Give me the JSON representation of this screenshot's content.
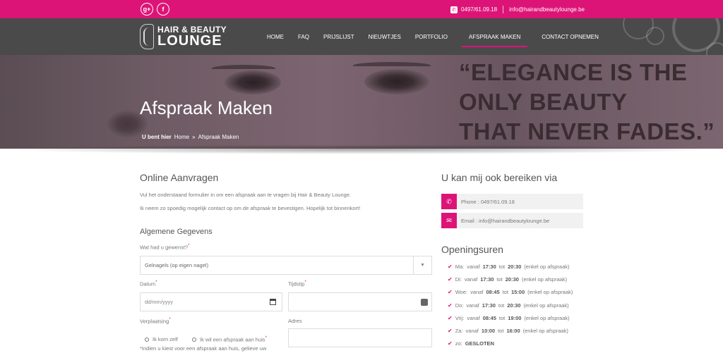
{
  "topbar": {
    "social": [
      {
        "name": "google-plus",
        "glyph": "g+"
      },
      {
        "name": "facebook",
        "glyph": "f"
      }
    ],
    "phone": "0497/61.09.18",
    "email": "info@hairandbeautylounge.be"
  },
  "logo": {
    "line1": "HAIR & BEAUTY",
    "line2": "LOUNGE"
  },
  "menu": [
    "HOME",
    "FAQ",
    "PRIJSLIJST",
    "NIEUWTJES",
    "PORTFOLIO",
    "AFSPRAAK MAKEN",
    "CONTACT OPNEMEN"
  ],
  "hero": {
    "title": "Afspraak Maken",
    "breadcrumb": {
      "prefix": "U bent hier",
      "home": "Home",
      "separator": "»",
      "current": "Afspraak Maken"
    },
    "quote": [
      "“ELEGANCE IS THE",
      "ONLY BEAUTY",
      "THAT NEVER FADES.”"
    ]
  },
  "form": {
    "heading": "Online Aanvragen",
    "intro1": "Vul het onderstaand formulier in om een afspraak aan te vragen bij Hair & Beauty Lounge.",
    "intro2": "Ik neem zo spoedig mogelijk contact op om de afspraak te bevestigen. Hopelijk tot binnenkort!",
    "section": "Algemene Gegevens",
    "wish_label": "Wat had u gewenst?",
    "wish_value": "Gelnagels (op eigen nagel)",
    "date_label": "Datum",
    "date_placeholder": "dd/mm/yyyy",
    "time_label": "Tijdstip",
    "move_label": "Verplaatsing",
    "radio1": "Ik kom zelf",
    "radio2": "Ik wil een afspraak aan huis",
    "note": "*Indien u kiest voor een afspraak aan huis, gelieve uw",
    "address_label": "Adres",
    "required_mark": "*"
  },
  "sidebar": {
    "reach_heading": "U kan mij ook bereiken via",
    "phone": "Phone : 0497/61.09.18",
    "email": "Email : info@hairandbeautylounge.be",
    "hours_heading": "Openingsuren",
    "hours": [
      {
        "day": "Ma:",
        "pre": "vanaf",
        "from": "17:30",
        "mid": "tot",
        "to": "20:30",
        "note": "(enkel op afspraak)"
      },
      {
        "day": "Di:",
        "pre": "vanaf",
        "from": "17:30",
        "mid": "tot",
        "to": "20:30",
        "note": "(enkel op afspraak)"
      },
      {
        "day": "Woe:",
        "pre": "vanaf",
        "from": "08:45",
        "mid": "tot",
        "to": "15:00",
        "note": "(enkel op afspraak)"
      },
      {
        "day": "Do:",
        "pre": "vanaf",
        "from": "17:30",
        "mid": "tot",
        "to": "20:30",
        "note": "(enkel op afspraak)"
      },
      {
        "day": "Vrij:",
        "pre": "vanaf",
        "from": "08:45",
        "mid": "tot",
        "to": "19:00",
        "note": "(enkel op afspraak)"
      },
      {
        "day": "Za:",
        "pre": "vanaf",
        "from": "10:00",
        "mid": "tot",
        "to": "16:00",
        "note": "(enkel op afspraak)"
      },
      {
        "day": "zo:",
        "pre": "",
        "from": "GESLOTEN",
        "mid": "",
        "to": "",
        "note": ""
      }
    ]
  },
  "colors": {
    "accent": "#dd1477",
    "nav": "#4a4a4a"
  }
}
